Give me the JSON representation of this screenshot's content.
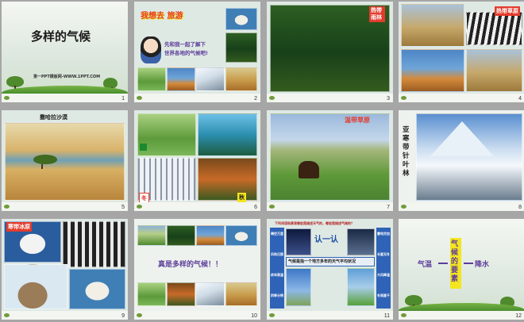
{
  "slides": [
    {
      "num": "1",
      "title": "多样的气候",
      "subtitle": "第一PPT模板网-WWW.1PPT.COM"
    },
    {
      "num": "2",
      "banner": "我想去旅游",
      "banner_prefix": "我想去",
      "banner_suffix": "旅游",
      "speech_line1": "先和我一起了解下",
      "speech_line2": "世界各地的气候吧!"
    },
    {
      "num": "3",
      "tag": "热带雨林"
    },
    {
      "num": "4",
      "tag": "热带草原"
    },
    {
      "num": "5",
      "title": "撒哈拉沙漠"
    },
    {
      "num": "6",
      "label_winter": "冬",
      "label_autumn": "秋"
    },
    {
      "num": "7",
      "title": "温带草原"
    },
    {
      "num": "8",
      "title": "亚寒带针叶林"
    },
    {
      "num": "9",
      "tag": "寒带冰原"
    },
    {
      "num": "10",
      "caption": "真是多样的气候！！"
    },
    {
      "num": "11",
      "question": "下列词语和景观哪些是描述天气的，哪些是描述气候的？",
      "heading": "认一认",
      "definition": "气候是指一个地方多年的天气平均状况",
      "left_labels": [
        "晴空万里",
        "风和日丽",
        "终年高温",
        "四季分明"
      ],
      "right_labels": [
        "雷电交加",
        "长夏无冬",
        "大风降温",
        "冬雨夏干"
      ]
    },
    {
      "num": "12",
      "left_word": "气温",
      "right_word": "降水",
      "center_title": "气候的要素"
    }
  ],
  "colors": {
    "title_dark": "#1a1a1a",
    "tag_red": "#e33b2c",
    "purple": "#5c3d9a",
    "yellow": "#f4e51f"
  }
}
